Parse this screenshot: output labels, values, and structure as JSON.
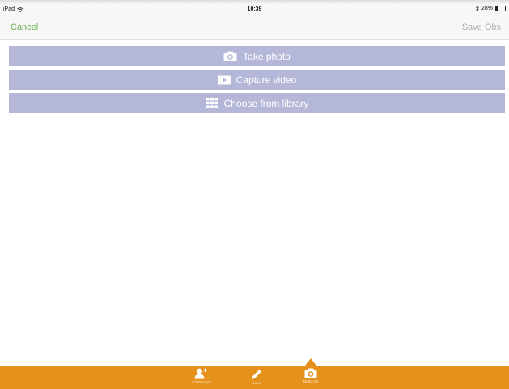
{
  "status_bar": {
    "device": "iPad",
    "time": "10:39",
    "battery_text": "28%",
    "battery_level": 0.28
  },
  "nav": {
    "cancel_label": "Cancel",
    "save_label": "Save Obs"
  },
  "media_options": [
    {
      "label": "Take photo",
      "icon": "camera-icon"
    },
    {
      "label": "Capture video",
      "icon": "video-play-icon"
    },
    {
      "label": "Choose from library",
      "icon": "grid-library-icon"
    }
  ],
  "tabs": [
    {
      "label": "Children (1)",
      "icon": "add-person-icon"
    },
    {
      "label": "Notes",
      "icon": "pencil-icon"
    },
    {
      "label": "Media (0)",
      "icon": "camera-icon",
      "selected": true
    }
  ],
  "colors": {
    "accent_green": "#6ab04c",
    "option_bg": "#b5b7d8",
    "tab_bar": "#e4921b",
    "save_disabled": "#aeaeae"
  }
}
